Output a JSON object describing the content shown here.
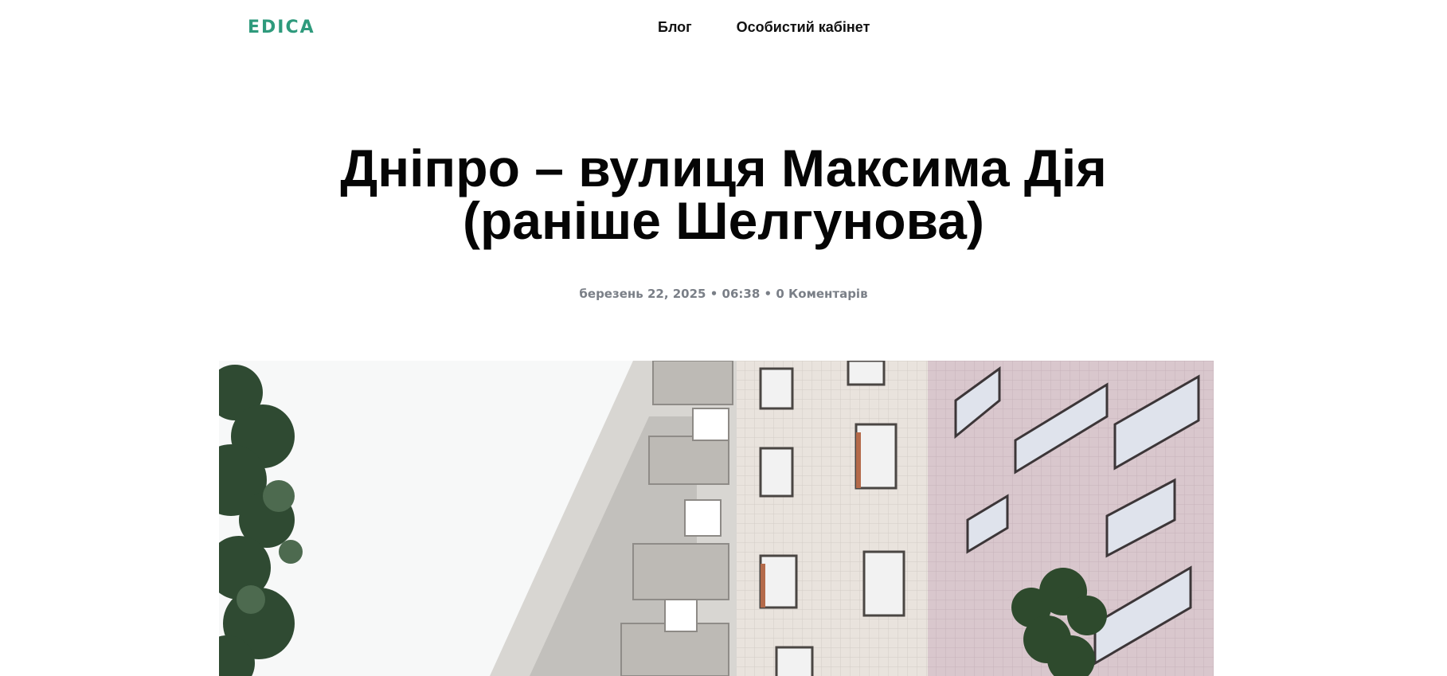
{
  "header": {
    "logo": "EDICA",
    "nav": [
      {
        "label": "Блог"
      },
      {
        "label": "Особистий кабінет"
      }
    ]
  },
  "article": {
    "title_line1": "Дніпро – вулиця Максима Дія",
    "title_line2": "(раніше Шелгунова)",
    "date": "березень 22, 2025",
    "time": "06:38",
    "separator": "•",
    "comments": "0 Коментарів"
  },
  "colors": {
    "brand": "#2e9a7c",
    "meta_text": "#7a7f87"
  },
  "hero_image": {
    "icon": "apartment-building-photo"
  }
}
